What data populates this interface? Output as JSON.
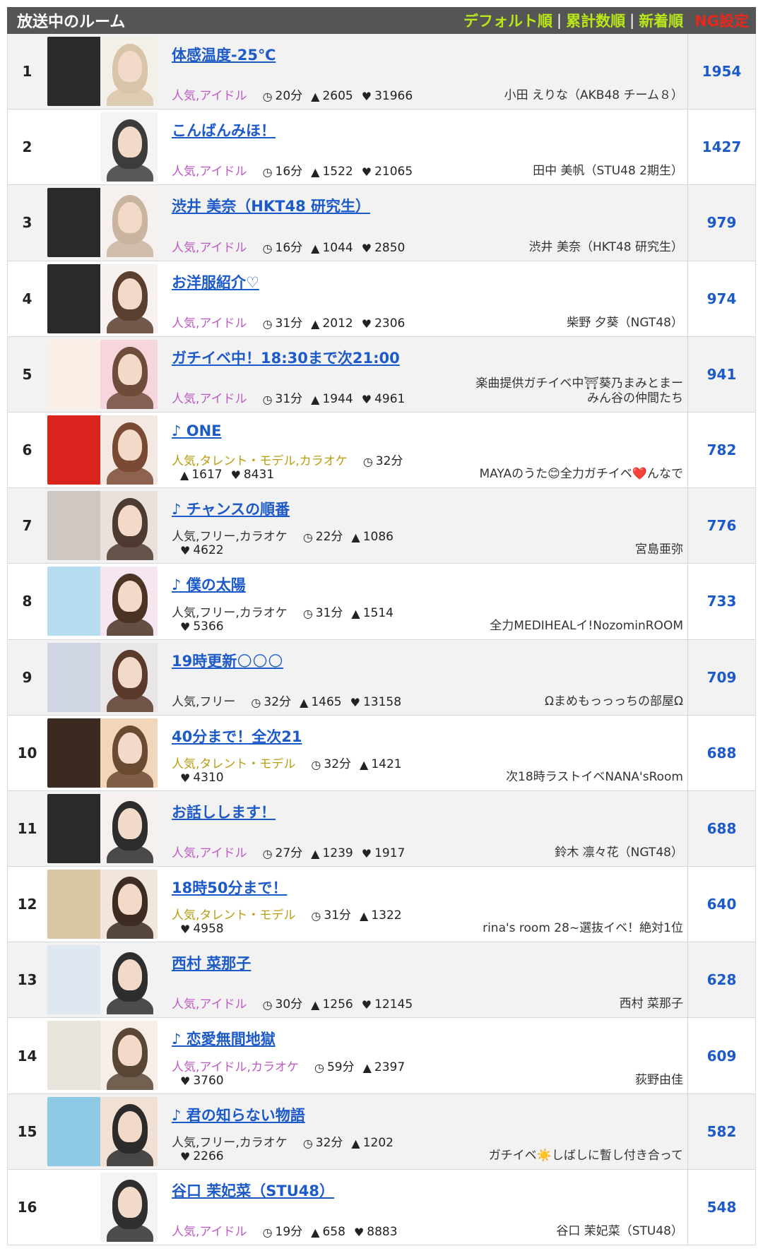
{
  "header": {
    "title": "放送中のルーム",
    "sort_default": "デフォルト順",
    "sort_total": "累計数順",
    "sort_new": "新着順",
    "separator": "|",
    "ng": "NG設定"
  },
  "icons": {
    "time": "clock-icon",
    "viewers": "person-icon",
    "likes": "heart-icon"
  },
  "rooms": [
    {
      "rank": "1",
      "title": "体感温度-25℃",
      "category": "人気,アイドル",
      "cat_color": "pink",
      "time": "20分",
      "viewers": "2605",
      "likes": "31966",
      "owner": "小田 えりな（AKB48 チーム８）",
      "count": "1954"
    },
    {
      "rank": "2",
      "title": "こんばんみほ！",
      "category": "人気,アイドル",
      "cat_color": "pink",
      "time": "16分",
      "viewers": "1522",
      "likes": "21065",
      "owner": "田中 美帆（STU48 2期生）",
      "count": "1427"
    },
    {
      "rank": "3",
      "title": "渋井 美奈（HKT48 研究生）",
      "category": "人気,アイドル",
      "cat_color": "pink",
      "time": "16分",
      "viewers": "1044",
      "likes": "2850",
      "owner": "渋井 美奈（HKT48 研究生）",
      "count": "979"
    },
    {
      "rank": "4",
      "title": "お洋服紹介♡",
      "category": "人気,アイドル",
      "cat_color": "pink",
      "time": "31分",
      "viewers": "2012",
      "likes": "2306",
      "owner": "柴野 夕葵（NGT48）",
      "count": "974"
    },
    {
      "rank": "5",
      "title": "ガチイベ中！18:30まで次21:00",
      "category": "人気,アイドル",
      "cat_color": "pink",
      "time": "31分",
      "viewers": "1944",
      "likes": "4961",
      "owner": "楽曲提供ガチイベ中⛩葵乃まみとまーみん谷の仲間たち",
      "count": "941"
    },
    {
      "rank": "6",
      "title": "♪ ONE",
      "category": "人気,タレント・モデル,カラオケ",
      "cat_color": "olive",
      "time": "32分",
      "viewers": "1617",
      "likes": "8431",
      "owner": "MAYAのうた😊全力ガチイベ❤️んなで",
      "count": "782"
    },
    {
      "rank": "7",
      "title": "♪ チャンスの順番",
      "category": "人気,フリー,カラオケ",
      "cat_color": "black",
      "time": "22分",
      "viewers": "1086",
      "likes": "4622",
      "owner": "宮島亜弥",
      "count": "776"
    },
    {
      "rank": "8",
      "title": "♪ 僕の太陽",
      "category": "人気,フリー,カラオケ",
      "cat_color": "black",
      "time": "31分",
      "viewers": "1514",
      "likes": "5366",
      "owner": "全力MEDIHEALイ!NozominROOM",
      "count": "733"
    },
    {
      "rank": "9",
      "title": "19時更新🌕🌕🌕",
      "category": "人気,フリー",
      "cat_color": "black",
      "time": "32分",
      "viewers": "1465",
      "likes": "13158",
      "owner": "Ωまめもっっっちの部屋Ω",
      "count": "709"
    },
    {
      "rank": "10",
      "title": "40分まで！全次21",
      "category": "人気,タレント・モデル",
      "cat_color": "olive",
      "time": "32分",
      "viewers": "1421",
      "likes": "4310",
      "owner": "次18時ラストイベNANA'sRoom",
      "count": "688"
    },
    {
      "rank": "11",
      "title": "お話しします！",
      "category": "人気,アイドル",
      "cat_color": "pink",
      "time": "27分",
      "viewers": "1239",
      "likes": "1917",
      "owner": "鈴木 凛々花（NGT48）",
      "count": "688"
    },
    {
      "rank": "12",
      "title": "18時50分まで！",
      "category": "人気,タレント・モデル",
      "cat_color": "olive",
      "time": "31分",
      "viewers": "1322",
      "likes": "4958",
      "owner": "rina's room 28~選抜イベ！絶対1位",
      "count": "640"
    },
    {
      "rank": "13",
      "title": "西村 菜那子",
      "category": "人気,アイドル",
      "cat_color": "pink",
      "time": "30分",
      "viewers": "1256",
      "likes": "12145",
      "owner": "西村 菜那子",
      "count": "628"
    },
    {
      "rank": "14",
      "title": "♪ 恋愛無間地獄",
      "category": "人気,アイドル,カラオケ",
      "cat_color": "pink",
      "time": "59分",
      "viewers": "2397",
      "likes": "3760",
      "owner": "荻野由佳",
      "count": "609"
    },
    {
      "rank": "15",
      "title": "♪ 君の知らない物語",
      "category": "人気,フリー,カラオケ",
      "cat_color": "black",
      "time": "32分",
      "viewers": "1202",
      "likes": "2266",
      "owner": "ガチイベ☀️しばしに暫し付き合って",
      "count": "582"
    },
    {
      "rank": "16",
      "title": "谷口 茉妃菜（STU48）",
      "category": "人気,アイドル",
      "cat_color": "pink",
      "time": "19分",
      "viewers": "658",
      "likes": "8883",
      "owner": "谷口 茉妃菜（STU48）",
      "count": "548"
    }
  ]
}
